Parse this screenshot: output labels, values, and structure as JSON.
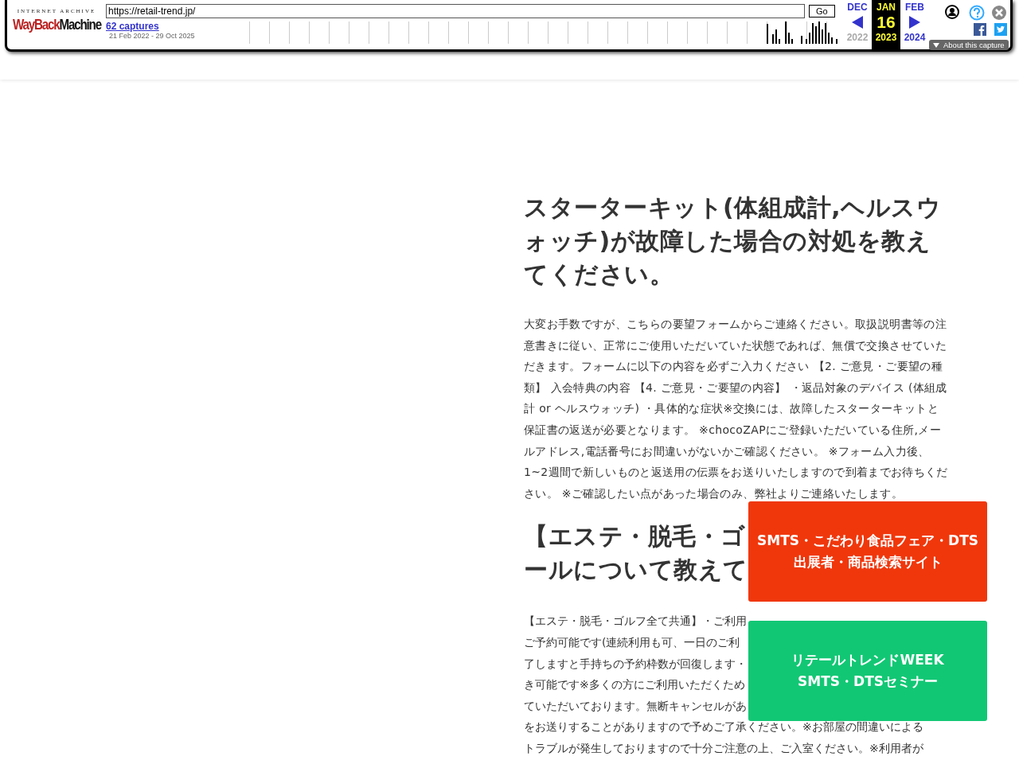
{
  "wayback": {
    "logo_top": "INTERNET ARCHIVE",
    "logo_way": "WayBack",
    "logo_machine": "Machine",
    "url": "https://retail-trend.jp/",
    "go": "Go",
    "captures": "62 captures",
    "range": "21 Feb 2022 - 29 Oct 2025",
    "months": [
      {
        "label": "DEC",
        "year": "2022",
        "selected": false
      },
      {
        "label": "JAN",
        "year": "2023",
        "day": "16",
        "selected": true
      },
      {
        "label": "FEB",
        "year": "2024",
        "selected": false
      }
    ],
    "about": "About this capture"
  },
  "faq": [
    {
      "kind": "full",
      "heading": "スターターキット(体組成計,ヘルスウォッチ)が故障した場合の対処を教えてください。",
      "body": "大変お手数ですが、こちらの要望フォームからご連絡ください。取扱説明書等の注意書きに従い、正常にご使用いただいていた状態であれば、無償で交換させていただきます。フォームに以下の内容を必ずご入力ください 【2. ご意見・ご要望の種類】 入会特典の内容 【4. ご意見・ご要望の内容】 ・返品対象のデバイス (体組成計 or ヘルスウォッチ) ・具体的な症状※交換には、故障したスターターキットと保証書の返送が必要となります。 ※chocoZAPにご登録いただいている住所,メールアドレス,電話番号にお間違いがないかご確認ください。 ※フォーム入力後、1~2週間で新しいものと返送用の伝票をお送りいたしますので到着までお待ちください。 ※ご確認したい点があった場合のみ、弊社よりご連絡いたします。"
    },
    {
      "kind": "lines",
      "heading_lines": [
        "【エステ・脱毛・ゴ",
        "ールについて教えて"
      ],
      "body_lines": [
        "【エステ・脱毛・ゴルフ全て共通】・ご利用",
        "ご予約可能です(連続利用も可、一日のご利",
        "了しますと手持ちの予約枠数が回復します・",
        "き可能です※多くの方にご利用いただくため",
        "ていただいております。無断キャンセルがあ",
        "をお送りすることがありますので予めご了承ください。※お部屋の間違いによる",
        "トラブルが発生しておりますので十分ご注意の上、ご入室ください。※利用者が"
      ]
    }
  ],
  "banners": [
    {
      "lines": [
        "SMTS・こだわり食品フェア・DTS",
        "出展者・商品検索サイト"
      ],
      "color": "#f0370c"
    },
    {
      "lines": [
        "リテールトレンドWEEK",
        "SMTS・DTSセミナー"
      ],
      "color": "#12c774"
    }
  ]
}
